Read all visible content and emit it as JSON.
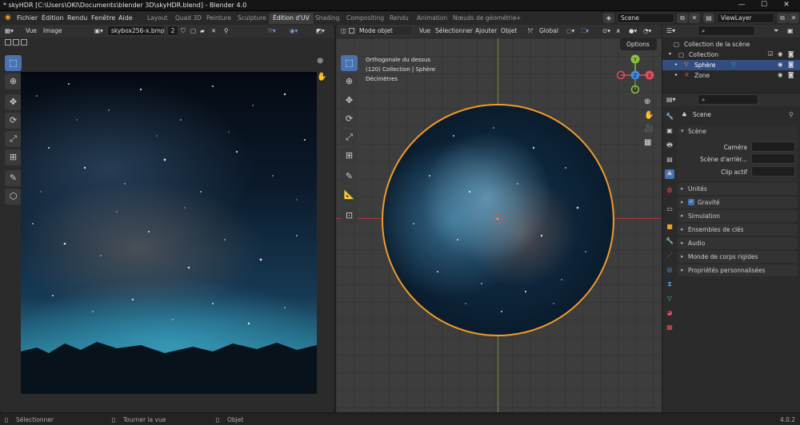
{
  "window": {
    "title": "* skyHDR [C:\\Users\\OKI\\Documents\\blender 3D\\skyHDR.blend] - Blender 4.0",
    "minimize": "—",
    "maximize": "☐",
    "close": "✕"
  },
  "menubar": {
    "logo": "◉",
    "items": [
      "Fichier",
      "Édition",
      "Rendu",
      "Fenêtre",
      "Aide"
    ],
    "workspaces": [
      "Layout",
      "Quad 3D",
      "Peinture",
      "Sculpture",
      "Édition d'UV",
      "Shading",
      "Compositing",
      "Rendu",
      "Animation",
      "Nœuds de géométrie"
    ],
    "active_workspace": "Édition d'UV",
    "add_tab": "+",
    "scene": "Scene",
    "view_layer": "ViewLayer"
  },
  "uv_editor": {
    "menus": [
      "Vue",
      "Image"
    ],
    "image_name": "skybox256-x.bmp",
    "users": "2",
    "tools": [
      "select",
      "cursor",
      "move",
      "rotate",
      "scale",
      "transform",
      "annotate",
      "grab-uv"
    ]
  },
  "viewport": {
    "mode": "Mode objet",
    "menus": [
      "Vue",
      "Sélectionner",
      "Ajouter",
      "Objet"
    ],
    "orientation": "Global",
    "options": "Options",
    "overlay_lines": [
      "Orthogonale du dessus",
      "(120) Collection | Sphère",
      "Décimètres"
    ],
    "gizmo_axes": [
      "Y",
      "X",
      "Z"
    ]
  },
  "outliner": {
    "search_placeholder": "",
    "rows": [
      {
        "label": "Collection de la scène"
      },
      {
        "label": "Collection"
      },
      {
        "label": "Sphère",
        "selected": true
      },
      {
        "label": "Zone"
      }
    ]
  },
  "properties": {
    "context": "Scene",
    "section": "Scène",
    "fields": [
      {
        "label": "Caméra",
        "value": ""
      },
      {
        "label": "Scène d'arrièr...",
        "value": ""
      },
      {
        "label": "Clip actif",
        "value": ""
      }
    ],
    "panels": [
      "Unités",
      "Gravité",
      "Simulation",
      "Ensembles de clés",
      "Audio",
      "Monde de corps rigides",
      "Propriétés personnalisées"
    ],
    "gravity_enabled": true
  },
  "statusbar": {
    "left": "Sélectionner",
    "middle": "Tourner la vue",
    "right": "Objet",
    "version": "4.0.2"
  },
  "colors": {
    "accent": "#4772b3",
    "selection_outline": "#f39b29",
    "x_axis": "#e34c5c",
    "y_axis": "#8bc33f",
    "z_axis": "#3d8be0"
  }
}
